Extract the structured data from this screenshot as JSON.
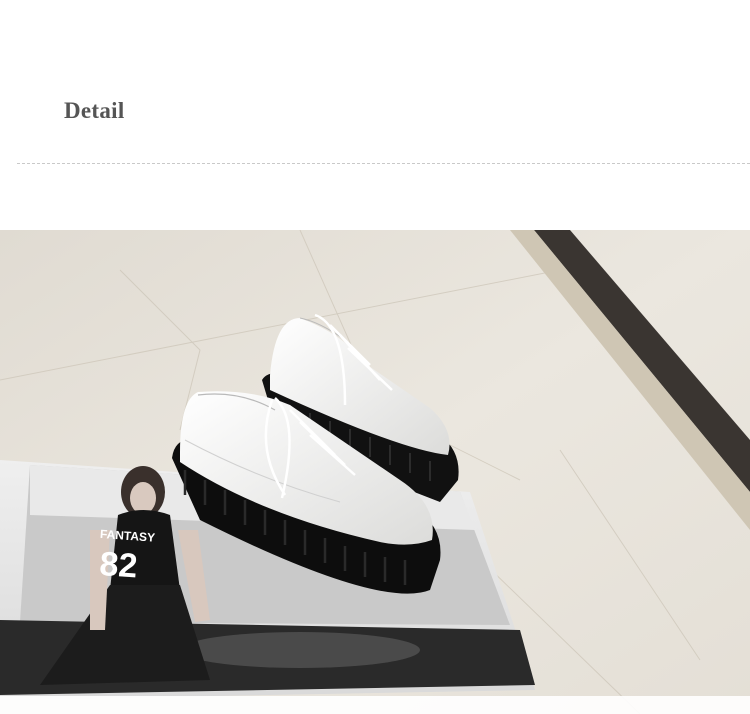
{
  "header": {
    "title": "Detail"
  },
  "photo": {
    "magazine_text_line1": "FANTASY",
    "magazine_text_line2": "82"
  },
  "colors": {
    "floor": "#e6e1d8",
    "marble_border": "#3a3531",
    "shoe_white": "#f4f4f2",
    "sole_black": "#111111"
  }
}
